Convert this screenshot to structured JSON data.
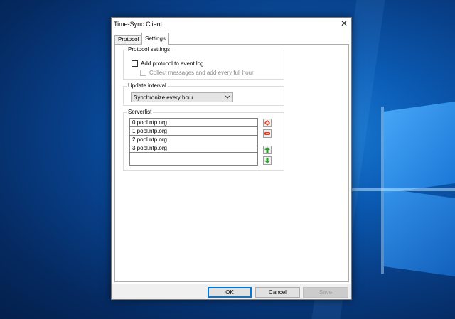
{
  "window": {
    "title": "Time-Sync Client",
    "close_glyph": "✕"
  },
  "tabs": [
    {
      "label": "Protocol",
      "active": false
    },
    {
      "label": "Settings",
      "active": true
    }
  ],
  "protocol_settings": {
    "label": "Protocol settings",
    "add_to_event_log": {
      "label": "Add protocol to event log",
      "checked": false
    },
    "collect_messages": {
      "label": "Collect messages and add every full hour",
      "checked": false,
      "enabled": false
    }
  },
  "update_interval": {
    "label": "Update interval",
    "selected": "Synchronize every hour"
  },
  "serverlist": {
    "label": "Serverlist",
    "servers": [
      "0.pool.ntp.org",
      "1.pool.ntp.org",
      "2.pool.ntp.org",
      "3.pool.ntp.org",
      ""
    ],
    "buttons": {
      "add": {
        "icon": "add-icon",
        "color": "#e03a1e"
      },
      "remove": {
        "icon": "remove-icon",
        "color": "#e03a1e"
      },
      "move_up": {
        "icon": "arrow-up-icon",
        "color": "#2fa02f"
      },
      "move_down": {
        "icon": "arrow-down-icon",
        "color": "#2fa02f"
      }
    }
  },
  "footer": {
    "ok_label": "OK",
    "cancel_label": "Cancel",
    "save_label": "Save"
  },
  "colors": {
    "accent": "#0078d7",
    "desktop_bg": "#0b5bb4"
  }
}
